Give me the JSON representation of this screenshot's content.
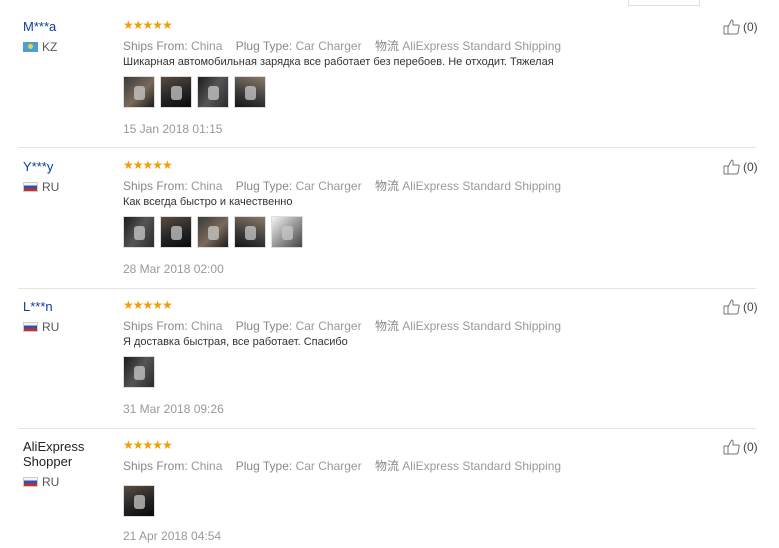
{
  "labels": {
    "ships_from": "Ships From:",
    "plug_type": "Plug Type:",
    "shipping": "物流"
  },
  "reviews": [
    {
      "user": "M***a",
      "country": "KZ",
      "stars": "★★★★★",
      "ships_from": "China",
      "plug_type": "Car Charger",
      "shipping": "AliExpress Standard Shipping",
      "comment": "Шикарная автомобильная зарядка все работает без перебоев. Не отходит. Тяжелая",
      "photo_count": 4,
      "date": "15 Jan 2018 01:15",
      "useful_count": "(0)"
    },
    {
      "user": "Y***y",
      "country": "RU",
      "stars": "★★★★★",
      "ships_from": "China",
      "plug_type": "Car Charger",
      "shipping": "AliExpress Standard Shipping",
      "comment": "Как всегда быстро и качественно",
      "photo_count": 5,
      "date": "28 Mar 2018 02:00",
      "useful_count": "(0)"
    },
    {
      "user": "L***n",
      "country": "RU",
      "stars": "★★★★★",
      "ships_from": "China",
      "plug_type": "Car Charger",
      "shipping": "AliExpress Standard Shipping",
      "comment": "Я доставка быстрая, все работает. Спасибо",
      "photo_count": 1,
      "date": "31 Mar 2018 09:26",
      "useful_count": "(0)"
    },
    {
      "user": "AliExpress Shopper",
      "country": "RU",
      "stars": "★★★★★",
      "ships_from": "China",
      "plug_type": "Car Charger",
      "shipping": "AliExpress Standard Shipping",
      "comment": "",
      "photo_count": 1,
      "date": "21 Apr 2018 04:54",
      "useful_count": "(0)"
    }
  ]
}
